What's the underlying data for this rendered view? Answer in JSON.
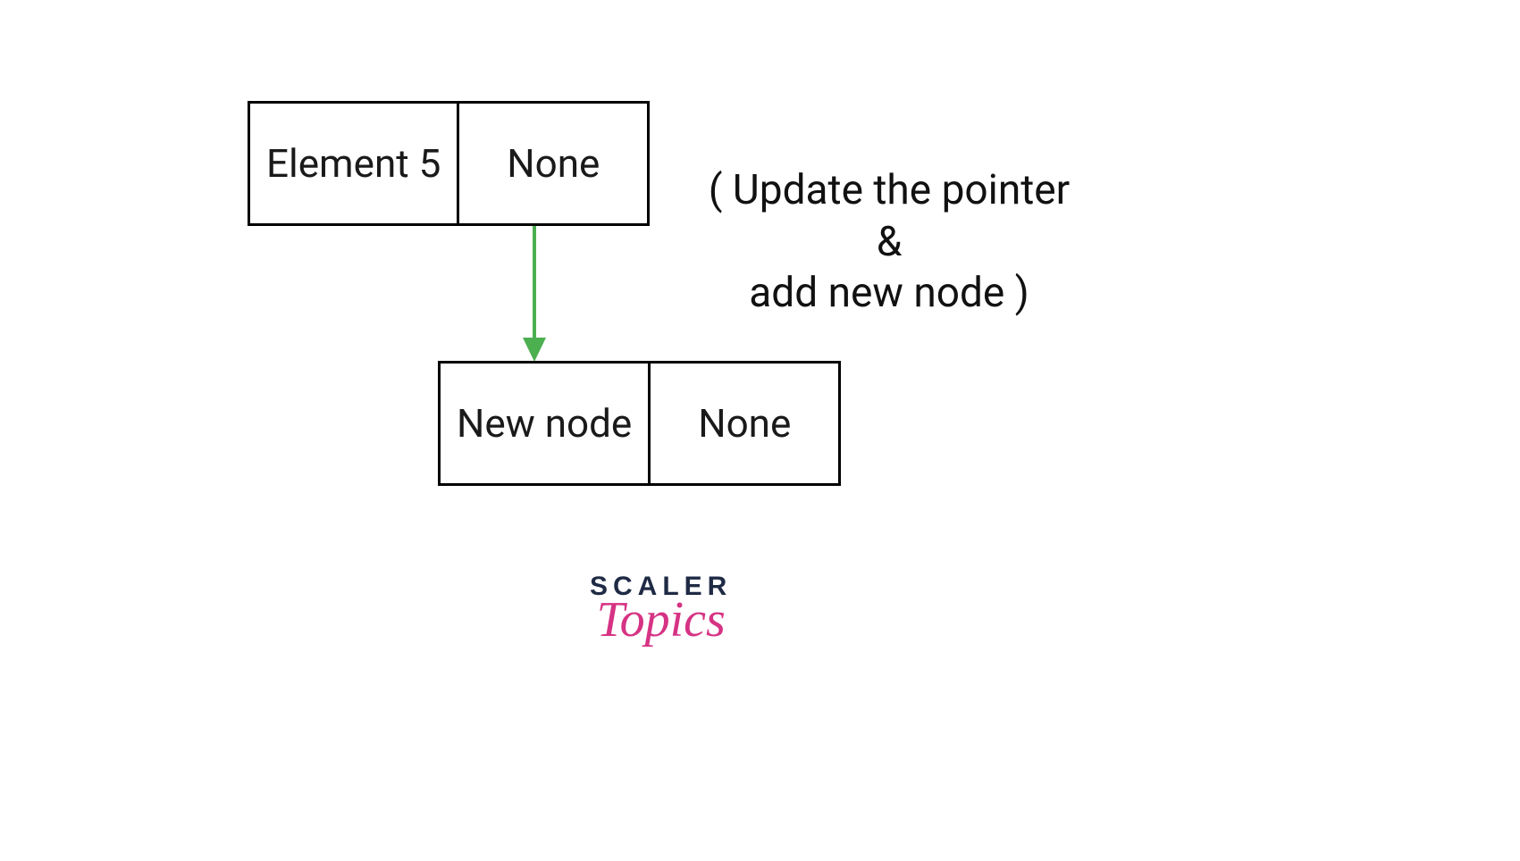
{
  "diagram": {
    "node1": {
      "data": "Element 5",
      "next": "None"
    },
    "node2": {
      "data": "New node",
      "next": "None"
    },
    "caption_line1": "( Update the pointer",
    "caption_line2": "&",
    "caption_line3": "add new node )",
    "arrow_color": "#4caf50"
  },
  "branding": {
    "line1": "SCALER",
    "line2": "Topics"
  }
}
